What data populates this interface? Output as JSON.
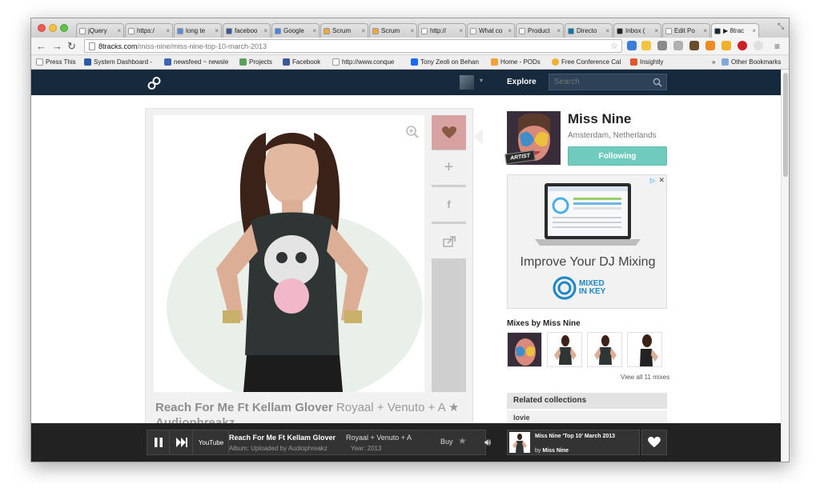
{
  "browser": {
    "tabs": [
      {
        "label": "jQuery",
        "favicon_color": "#ffffff"
      },
      {
        "label": "https:/",
        "favicon_color": "#ffffff"
      },
      {
        "label": "long te",
        "favicon_color": "#5b8dd6"
      },
      {
        "label": "faceboo",
        "favicon_color": "#3b5998"
      },
      {
        "label": "Google",
        "favicon_color": "#4a86e8"
      },
      {
        "label": "Scrum",
        "favicon_color": "#f2a93b"
      },
      {
        "label": "Scrum",
        "favicon_color": "#f2a93b"
      },
      {
        "label": "http://",
        "favicon_color": "#ffffff"
      },
      {
        "label": "What co",
        "favicon_color": "#ffffff"
      },
      {
        "label": "Product",
        "favicon_color": "#ffffff"
      },
      {
        "label": "Directo",
        "favicon_color": "#0e76a8"
      },
      {
        "label": "Inbox (",
        "favicon_color": "#222222"
      },
      {
        "label": "Edit Po",
        "favicon_color": "#ffffff"
      },
      {
        "label": "▶ 8trac",
        "favicon_color": "#172a3d"
      }
    ],
    "url": {
      "host": "8tracks.com",
      "path": "/miss-nine/miss-nine-top-10-march-2013"
    },
    "bookmarks": [
      {
        "label": "Press This",
        "color": "#ffffff"
      },
      {
        "label": "System Dashboard -",
        "color": "#2b5aa6"
      },
      {
        "label": "newsfeed ~ newsle",
        "color": "#3d67b5"
      },
      {
        "label": "Projects",
        "color": "#5aa05a"
      },
      {
        "label": "Facebook",
        "color": "#3b5998"
      },
      {
        "label": "http://www.conque",
        "color": "#ffffff"
      },
      {
        "label": "Tony Zeoli on Behan",
        "color": "#1769ff"
      },
      {
        "label": "Home - PODs",
        "color": "#f4a13a"
      },
      {
        "label": "Free Conference Cal",
        "color": "#f0b030"
      },
      {
        "label": "Insightly",
        "color": "#e0562a"
      }
    ],
    "bookmarks_overflow": "»",
    "other_bookmarks": "Other Bookmarks"
  },
  "site": {
    "nav_explore": "Explore",
    "search_placeholder": "Search"
  },
  "mix": {
    "track_title": "Reach For Me Ft Kellam Glover",
    "track_artist": "Royaal + Venuto + A",
    "track_title_second_line": "Audiophreakz"
  },
  "artist": {
    "name": "Miss Nine",
    "location": "Amsterdam, Netherlands",
    "badge": "ARTIST",
    "follow_label": "Following"
  },
  "ad": {
    "headline": "Improve Your DJ Mixing",
    "brand_line1": "MIXED",
    "brand_line2": "IN KEY",
    "choices": "▷",
    "close": "✕"
  },
  "sidebar": {
    "mixes_heading": "Mixes by Miss Nine",
    "view_all": "View all 11 mixes",
    "related_heading": "Related collections",
    "related_first": "lovie"
  },
  "player": {
    "title": "Reach For Me Ft Kellam Glover",
    "artist": "Royaal + Venuto + A",
    "album_label": "Album:",
    "album": "Uploaded by Audiophreakz",
    "year_label": "Year:",
    "year": "2013",
    "buy_label": "Buy",
    "youtube_label": "YouTube",
    "mini_title": "Miss Nine 'Top 10' March 2013",
    "mini_by_label": "by",
    "mini_by": "Miss Nine"
  }
}
